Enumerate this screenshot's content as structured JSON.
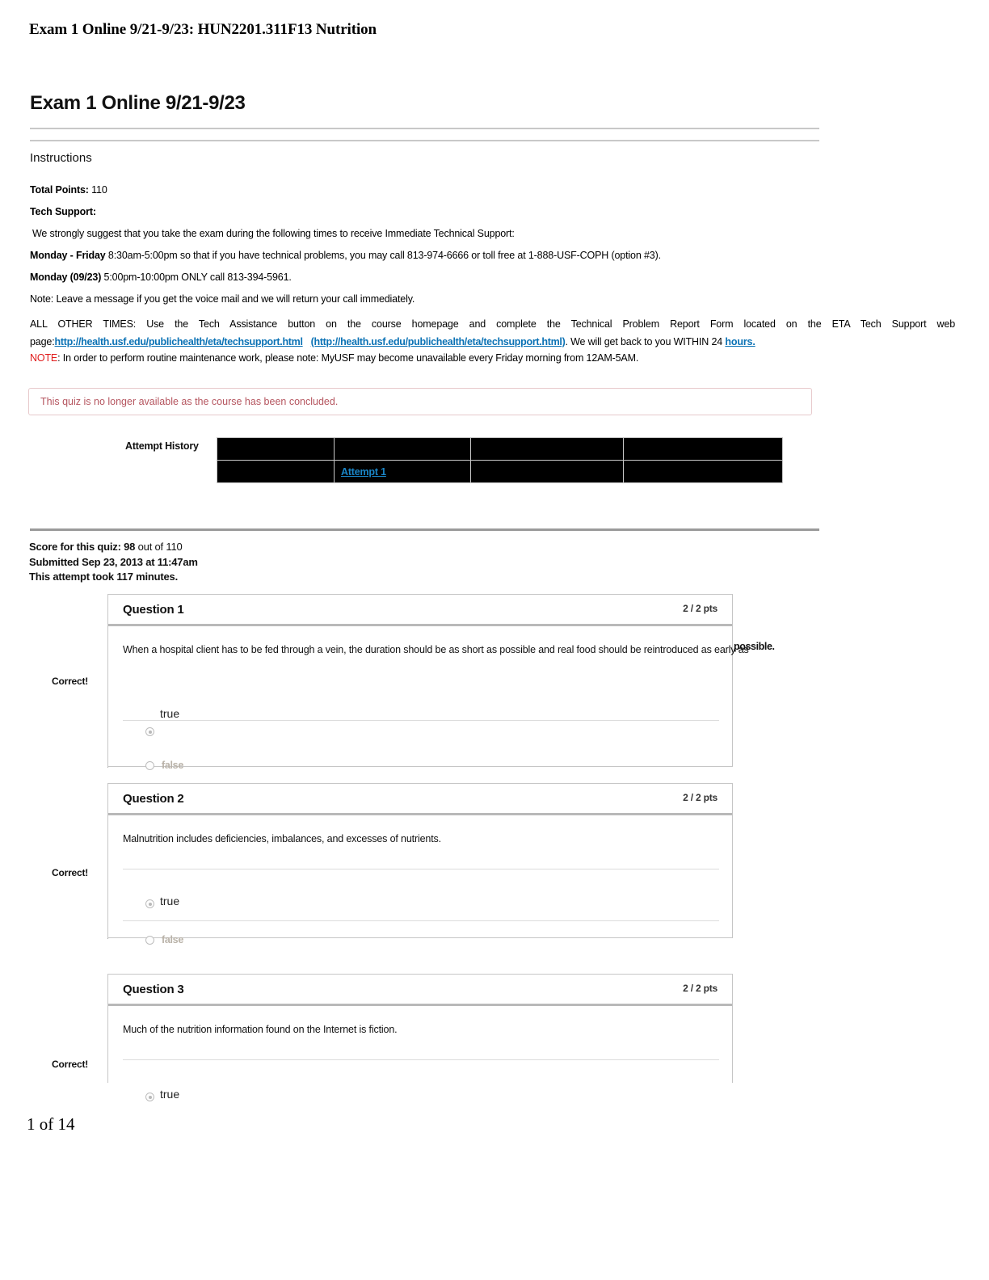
{
  "running_header": "Exam 1 Online 9/21-9/23: HUN2201.311F13 Nutrition",
  "running_footer": "1 of 14",
  "quiz": {
    "title": "Exam 1 Online 9/21-9/23",
    "instructions_heading": "Instructions"
  },
  "instructions": {
    "total_points_label": "Total Points:",
    "total_points_value": "110",
    "tech_support_heading": "Tech Support:",
    "suggestion": "We strongly suggest that you take the exam during the following times to receive Immediate Technical Support:",
    "mon_fri_label": "Monday - Friday",
    "mon_fri_text": "8:30am-5:00pm so that if you have technical problems, you may call 813-974-6666 or toll free at 1-888-USF-COPH (option #3).",
    "monday_label": "Monday (09/23)",
    "monday_text": "5:00pm-10:00pm ONLY call 813-394-5961.",
    "note_voicemail": "Note: Leave a message if you get the voice mail and we will return your call immediately.",
    "all_other_times_pre": "ALL OTHER TIMES: Use the Tech Assistance button on the course homepage and complete the Technical Problem Report Form located on the ETA Tech Support web page:",
    "link_primary": "http://health.usf.edu/publichealth/eta/techsupport.html",
    "link_parenthetical": "(http://health.usf.edu/publichealth/eta/techsupport.html)",
    "after_links": ". We will get back to you WITHIN 24",
    "link_hours": "hours.",
    "note_label": "NOTE",
    "maintenance": ": In order to perform routine maintenance work, please note: MyUSF may become unavailable every Friday morning from 12AM-5AM."
  },
  "alert": {
    "message": "This quiz is no longer available as the course has been concluded."
  },
  "attempt_history": {
    "label": "Attempt History",
    "columns": [
      "",
      "",
      "",
      ""
    ],
    "rows": [
      [
        "",
        "",
        "",
        ""
      ],
      [
        "",
        "Attempt 1",
        "",
        ""
      ]
    ],
    "attempt_link_label": "Attempt 1"
  },
  "score": {
    "score_label": "Score for this quiz:",
    "score_value": "98",
    "score_out_of": "out of 110",
    "submitted": "Submitted Sep 23, 2013 at 11:47am",
    "duration": "This attempt took 117 minutes."
  },
  "questions": [
    {
      "title": "Question 1",
      "points": "2 / 2 pts",
      "text": "When a hospital client has to be fed through a vein, the duration should be as short as possible and real food should be reintroduced as early as",
      "text_overflow": "possible.",
      "correct_flag": "Correct!",
      "options": [
        {
          "label": "true",
          "selected": true
        },
        {
          "label": "false",
          "selected": false
        }
      ]
    },
    {
      "title": "Question 2",
      "points": "2 / 2 pts",
      "text": "Malnutrition includes deficiencies, imbalances, and excesses of nutrients.",
      "text_overflow": "",
      "correct_flag": "Correct!",
      "options": [
        {
          "label": "true",
          "selected": true
        },
        {
          "label": "false",
          "selected": false
        }
      ]
    },
    {
      "title": "Question 3",
      "points": "2 / 2 pts",
      "text": "Much of the nutrition information found on the Internet is fiction.",
      "text_overflow": "",
      "correct_flag": "Correct!",
      "options": [
        {
          "label": "true",
          "selected": true
        }
      ]
    }
  ],
  "colors": {
    "link": "#0b72b5",
    "table_link": "#1a86c8",
    "note_red": "#e01b1b",
    "alert_text": "#b5555f",
    "alert_border": "#e7c9cb"
  }
}
